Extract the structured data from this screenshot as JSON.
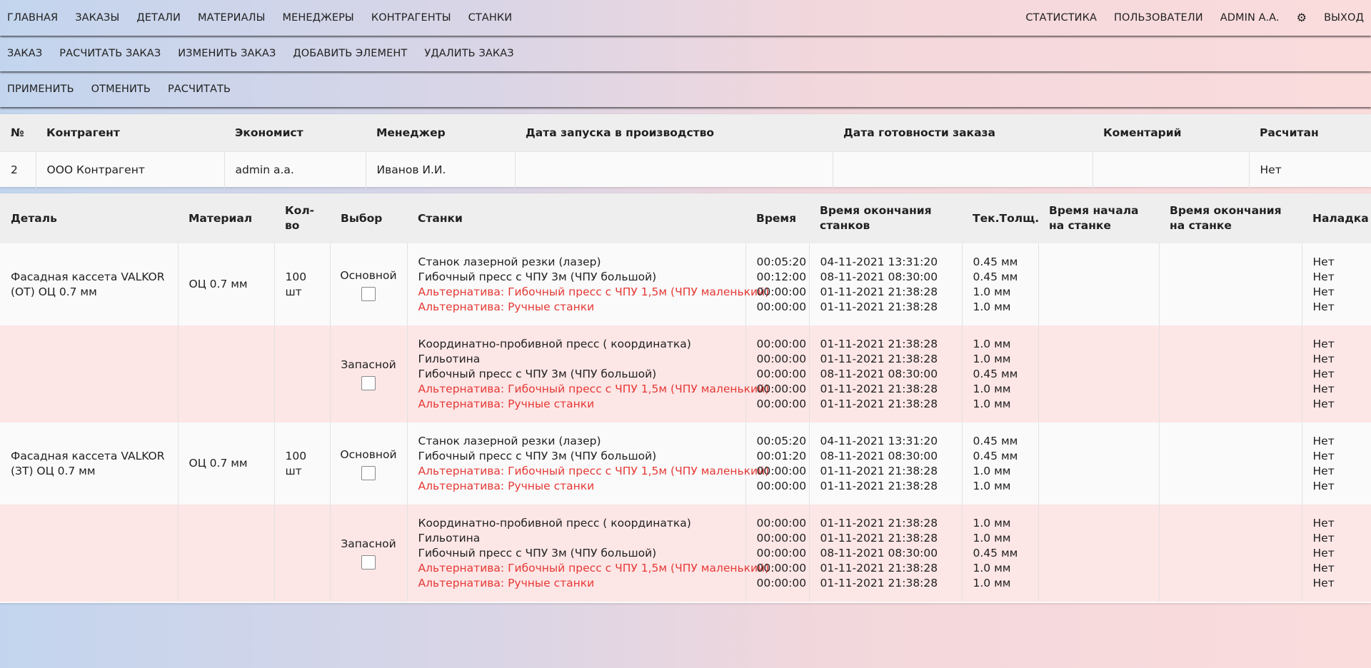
{
  "nav": {
    "left": [
      "ГЛАВНАЯ",
      "ЗАКАЗЫ",
      "ДЕТАЛИ",
      "МАТЕРИАЛЫ",
      "МЕНЕДЖЕРЫ",
      "КОНТРАГЕНТЫ",
      "СТАНКИ"
    ],
    "right": {
      "stats": "СТАТИСТИКА",
      "users": "ПОЛЬЗОВАТЕЛИ",
      "user": "ADMIN A.A.",
      "gear_icon": "⚙",
      "exit": "ВЫХОД"
    }
  },
  "order_menu": [
    "ЗАКАЗ",
    "РАСЧИТАТЬ ЗАКАЗ",
    "ИЗМЕНИТЬ ЗАКАЗ",
    "ДОБАВИТЬ ЭЛЕМЕНТ",
    "УДАЛИТЬ ЗАКАЗ"
  ],
  "actions": [
    "ПРИМЕНИТЬ",
    "ОТМЕНИТЬ",
    "РАСЧИТАТЬ"
  ],
  "order": {
    "headers": [
      "№",
      "Контрагент",
      "Экономист",
      "Менеджер",
      "Дата запуска в производство",
      "Дата готовности заказа",
      "Коментарий",
      "Расчитан"
    ],
    "row": [
      "2",
      "ООО Контрагент",
      "admin a.a.",
      "Иванов И.И.",
      "",
      "",
      "",
      "Нет"
    ]
  },
  "details": {
    "headers": [
      "Деталь",
      "Материал",
      "Кол-во",
      "Выбор",
      "Станки",
      "Время",
      "Время окончания станков",
      "Тек.Толщ.",
      "Время начала на станке",
      "Время окончания на станке",
      "Наладка"
    ],
    "rows": [
      {
        "detail": "Фасадная кассета VALKOR (ОТ) ОЦ 0.7 мм",
        "material": "ОЦ 0.7 мм",
        "qty": "100 шт",
        "choice": "Основной",
        "machines": [
          {
            "name": "Станок лазерной резки (лазер)",
            "alt": false
          },
          {
            "name": "Гибочный пресс с ЧПУ 3м (ЧПУ большой)",
            "alt": false
          },
          {
            "name": "Альтернатива: Гибочный пресс с ЧПУ 1,5м (ЧПУ маленький)",
            "alt": true
          },
          {
            "name": "Альтернатива: Ручные станки",
            "alt": true
          }
        ],
        "time": [
          "00:05:20",
          "00:12:00",
          "00:00:00",
          "00:00:00"
        ],
        "end": [
          "04-11-2021 13:31:20",
          "08-11-2021 08:30:00",
          "01-11-2021 21:38:28",
          "01-11-2021 21:38:28"
        ],
        "thick": [
          "0.45 мм",
          "0.45 мм",
          "1.0 мм",
          "1.0 мм"
        ],
        "setup": [
          "Нет",
          "Нет",
          "Нет",
          "Нет"
        ]
      },
      {
        "detail": "",
        "material": "",
        "qty": "",
        "choice": "Запасной",
        "machines": [
          {
            "name": "Координатно-пробивной пресс ( координатка)",
            "alt": false
          },
          {
            "name": "Гильотина",
            "alt": false
          },
          {
            "name": "Гибочный пресс с ЧПУ 3м (ЧПУ большой)",
            "alt": false
          },
          {
            "name": "Альтернатива: Гибочный пресс с ЧПУ 1,5м (ЧПУ маленький)",
            "alt": true
          },
          {
            "name": "Альтернатива: Ручные станки",
            "alt": true
          }
        ],
        "time": [
          "00:00:00",
          "00:00:00",
          "00:00:00",
          "00:00:00",
          "00:00:00"
        ],
        "end": [
          "01-11-2021 21:38:28",
          "01-11-2021 21:38:28",
          "08-11-2021 08:30:00",
          "01-11-2021 21:38:28",
          "01-11-2021 21:38:28"
        ],
        "thick": [
          "1.0 мм",
          "1.0 мм",
          "0.45 мм",
          "1.0 мм",
          "1.0 мм"
        ],
        "setup": [
          "Нет",
          "Нет",
          "Нет",
          "Нет",
          "Нет"
        ]
      },
      {
        "detail": "Фасадная кассета VALKOR (ЗТ) ОЦ 0.7 мм",
        "material": "ОЦ 0.7 мм",
        "qty": "100 шт",
        "choice": "Основной",
        "machines": [
          {
            "name": "Станок лазерной резки (лазер)",
            "alt": false
          },
          {
            "name": "Гибочный пресс с ЧПУ 3м (ЧПУ большой)",
            "alt": false
          },
          {
            "name": "Альтернатива: Гибочный пресс с ЧПУ 1,5м (ЧПУ маленький)",
            "alt": true
          },
          {
            "name": "Альтернатива: Ручные станки",
            "alt": true
          }
        ],
        "time": [
          "00:05:20",
          "00:01:20",
          "00:00:00",
          "00:00:00"
        ],
        "end": [
          "04-11-2021 13:31:20",
          "08-11-2021 08:30:00",
          "01-11-2021 21:38:28",
          "01-11-2021 21:38:28"
        ],
        "thick": [
          "0.45 мм",
          "0.45 мм",
          "1.0 мм",
          "1.0 мм"
        ],
        "setup": [
          "Нет",
          "Нет",
          "Нет",
          "Нет"
        ]
      },
      {
        "detail": "",
        "material": "",
        "qty": "",
        "choice": "Запасной",
        "machines": [
          {
            "name": "Координатно-пробивной пресс ( координатка)",
            "alt": false
          },
          {
            "name": "Гильотина",
            "alt": false
          },
          {
            "name": "Гибочный пресс с ЧПУ 3м (ЧПУ большой)",
            "alt": false
          },
          {
            "name": "Альтернатива: Гибочный пресс с ЧПУ 1,5м (ЧПУ маленький)",
            "alt": true
          },
          {
            "name": "Альтернатива: Ручные станки",
            "alt": true
          }
        ],
        "time": [
          "00:00:00",
          "00:00:00",
          "00:00:00",
          "00:00:00",
          "00:00:00"
        ],
        "end": [
          "01-11-2021 21:38:28",
          "01-11-2021 21:38:28",
          "08-11-2021 08:30:00",
          "01-11-2021 21:38:28",
          "01-11-2021 21:38:28"
        ],
        "thick": [
          "1.0 мм",
          "1.0 мм",
          "0.45 мм",
          "1.0 мм",
          "1.0 мм"
        ],
        "setup": [
          "Нет",
          "Нет",
          "Нет",
          "Нет",
          "Нет"
        ]
      }
    ]
  },
  "colors": {
    "alt_text": "#e53935",
    "backup_row": "#fde6e6",
    "header_bg": "#eeeeee"
  }
}
